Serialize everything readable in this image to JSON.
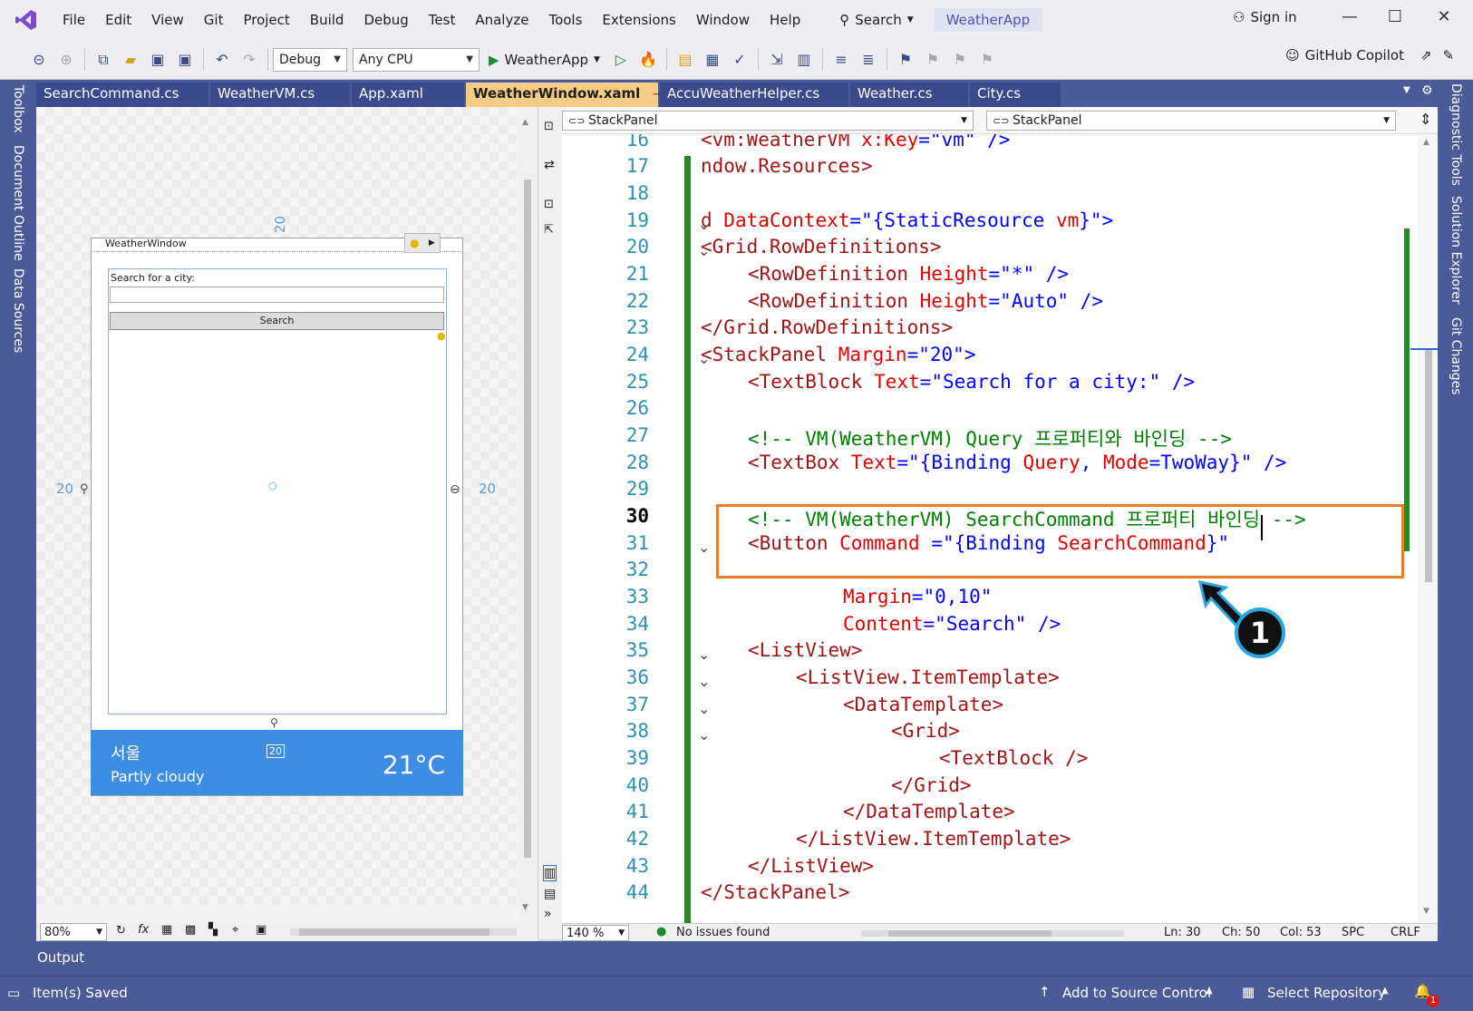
{
  "menu": {
    "items": [
      "File",
      "Edit",
      "View",
      "Git",
      "Project",
      "Build",
      "Debug",
      "Test",
      "Analyze",
      "Tools",
      "Extensions",
      "Window",
      "Help"
    ],
    "search_label": "Search",
    "app_name": "WeatherApp",
    "sign_in": "Sign in"
  },
  "toolbar": {
    "config": "Debug",
    "platform": "Any CPU",
    "run_target": "WeatherApp",
    "copilot": "GitHub Copilot"
  },
  "side_left": {
    "toolbox": "Toolbox",
    "document_outline": "Document Outline",
    "data_sources": "Data Sources"
  },
  "side_right": {
    "diagnostic": "Diagnostic Tools",
    "solution_explorer": "Solution Explorer",
    "git_changes": "Git Changes"
  },
  "tabs": [
    "SearchCommand.cs",
    "WeatherVM.cs",
    "App.xaml",
    "WeatherWindow.xaml",
    "AccuWeatherHelper.cs",
    "Weather.cs",
    "City.cs"
  ],
  "designer": {
    "window_title": "WeatherWindow",
    "search_label": "Search for a city:",
    "button_label": "Search",
    "city": "서울",
    "condition": "Partly cloudy",
    "temp": "21°C",
    "dim_top": "20",
    "dim_left": "20",
    "dim_right": "20",
    "dim_bottom": "20",
    "zoom": "80%"
  },
  "nav": {
    "left": "StackPanel",
    "right": "StackPanel"
  },
  "editor": {
    "zoom": "140 %",
    "issues": "No issues found",
    "ln": "Ln: 30",
    "ch": "Ch: 50",
    "col": "Col: 53",
    "spc": "SPC",
    "crlf": "CRLF",
    "callout": "1"
  },
  "code": {
    "l16": {
      "num": "16",
      "tag": "<vm:WeatherVM ",
      "attr": "x:Key",
      "eq": "=",
      "val": "\"vm\"",
      "end": " />"
    },
    "l17": {
      "num": "17",
      "text": "ndow.Resources>"
    },
    "l18": {
      "num": "18"
    },
    "l19": {
      "num": "19",
      "pre": "d ",
      "attr": "DataContext",
      "eq": "=",
      "val": "\"{StaticResource ",
      "val2": "vm",
      "val3": "}\">"
    },
    "l20": {
      "num": "20",
      "text": "<Grid.RowDefinitions>"
    },
    "l21": {
      "num": "21",
      "tag": "<RowDefinition ",
      "attr": "Height",
      "eq": "=",
      "val": "\"*\"",
      "end": " />"
    },
    "l22": {
      "num": "22",
      "tag": "<RowDefinition ",
      "attr": "Height",
      "eq": "=",
      "val": "\"Auto\"",
      "end": " />"
    },
    "l23": {
      "num": "23",
      "text": "</Grid.RowDefinitions>"
    },
    "l24": {
      "num": "24",
      "tag": "<StackPanel ",
      "attr": "Margin",
      "eq": "=",
      "val": "\"20\"",
      "end": ">"
    },
    "l25": {
      "num": "25",
      "tag": "<TextBlock ",
      "attr": "Text",
      "eq": "=",
      "val": "\"Search for a city:\"",
      "end": " />"
    },
    "l26": {
      "num": "26"
    },
    "l27": {
      "num": "27",
      "comment": "<!-- VM(WeatherVM) Query 프로퍼티와 바인딩 -->"
    },
    "l28": {
      "num": "28",
      "tag": "<TextBox ",
      "attr": "Text",
      "eq": "=",
      "val": "\"{Binding ",
      "val2": "Query",
      "val3": ", ",
      "val4": "Mode",
      "val5": "=TwoWay}\"",
      "end": " />"
    },
    "l29": {
      "num": "29"
    },
    "l30": {
      "num": "30",
      "comment": "<!-- VM(WeatherVM) SearchCommand 프로퍼티 바인딩 -->"
    },
    "l31": {
      "num": "31",
      "tag": "<Button ",
      "attr": "Command ",
      "eq": "=",
      "val": "\"{Binding ",
      "val2": "SearchCommand",
      "val3": "}\""
    },
    "l32": {
      "num": "32"
    },
    "l33": {
      "num": "33",
      "attr": "Margin",
      "eq": "=",
      "val": "\"0,10\""
    },
    "l34": {
      "num": "34",
      "attr": "Content",
      "eq": "=",
      "val": "\"Search\"",
      "end": " />"
    },
    "l35": {
      "num": "35",
      "text": "<ListView>"
    },
    "l36": {
      "num": "36",
      "text": "<ListView.ItemTemplate>"
    },
    "l37": {
      "num": "37",
      "text": "<DataTemplate>"
    },
    "l38": {
      "num": "38",
      "text": "<Grid>"
    },
    "l39": {
      "num": "39",
      "text": "<TextBlock />"
    },
    "l40": {
      "num": "40",
      "text": "</Grid>"
    },
    "l41": {
      "num": "41",
      "text": "</DataTemplate>"
    },
    "l42": {
      "num": "42",
      "text": "</ListView.ItemTemplate>"
    },
    "l43": {
      "num": "43",
      "text": "</ListView>"
    },
    "l44": {
      "num": "44",
      "text": "</StackPanel>"
    }
  },
  "output": {
    "title": "Output"
  },
  "status": {
    "saved": "Item(s) Saved",
    "add_source": "Add to Source Control",
    "select_repo": "Select Repository",
    "notif_count": "1"
  }
}
